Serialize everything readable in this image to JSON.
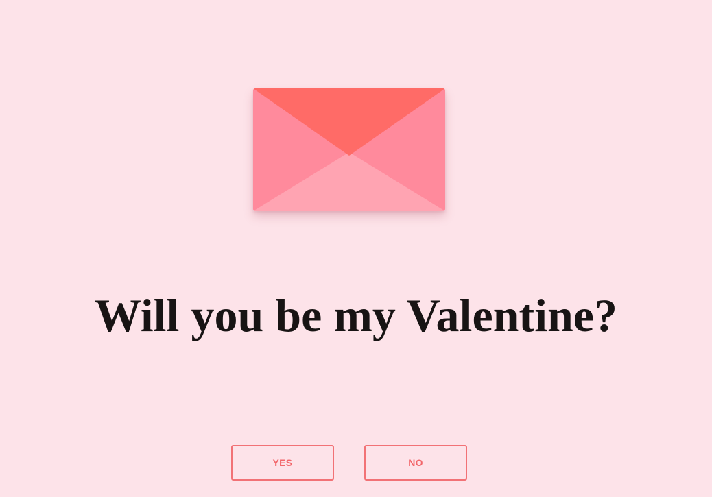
{
  "envelope": {
    "icon": "envelope-icon",
    "colors": {
      "flap": "#ff6b67",
      "sides": "#ff8a9c",
      "bottom": "#ffa4b2"
    }
  },
  "question": {
    "text": "Will you be my Valentine?"
  },
  "buttons": {
    "yes_label": "YES",
    "no_label": "NO"
  },
  "colors": {
    "background": "#fde3e9",
    "accent": "#f27276",
    "text": "#181414"
  }
}
